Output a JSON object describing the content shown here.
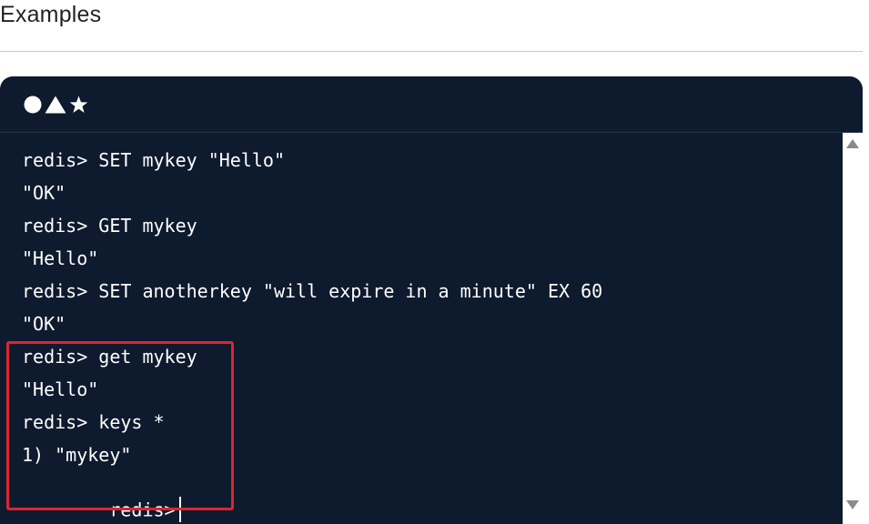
{
  "section": {
    "title": "Examples"
  },
  "terminal": {
    "header_icons": [
      "circle-icon",
      "triangle-icon",
      "star-icon"
    ],
    "lines": [
      "redis> SET mykey \"Hello\"",
      "\"OK\"",
      "redis> GET mykey",
      "\"Hello\"",
      "redis> SET anotherkey \"will expire in a minute\" EX 60",
      "\"OK\"",
      "redis> get mykey",
      "\"Hello\"",
      "redis> keys *",
      "1) \"mykey\"",
      "redis>"
    ],
    "highlight_color": "#e0242e",
    "background_color": "#0e1a2e"
  }
}
